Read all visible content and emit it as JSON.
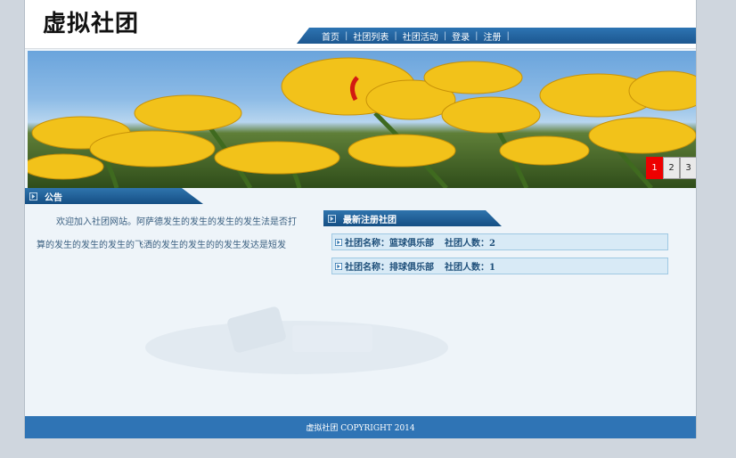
{
  "header": {
    "title": "虚拟社团"
  },
  "nav": {
    "items": [
      "首页",
      "社团列表",
      "社团活动",
      "登录",
      "注册"
    ]
  },
  "slider": {
    "buttons": [
      "1",
      "2",
      "3"
    ],
    "active": 1
  },
  "notice": {
    "title": "公告",
    "text": "欢迎加入社团网站。阿萨德发生的发生的发生的发生法是否打算的发生的发生的发生的飞洒的发生的发生的的发生发达是短发"
  },
  "new_clubs": {
    "title": "最新注册社团",
    "items": [
      {
        "name_label": "社团名称：篮球俱乐部",
        "count_label": "社团人数：2"
      },
      {
        "name_label": "社团名称：排球俱乐部",
        "count_label": "社团人数：1"
      }
    ]
  },
  "footer": {
    "copyright": "虚拟社团 COPYRIGHT 2014"
  },
  "colors": {
    "nav_blue": "#1c5790",
    "footer_blue": "#2f74b5",
    "active_red": "#ee0000"
  }
}
